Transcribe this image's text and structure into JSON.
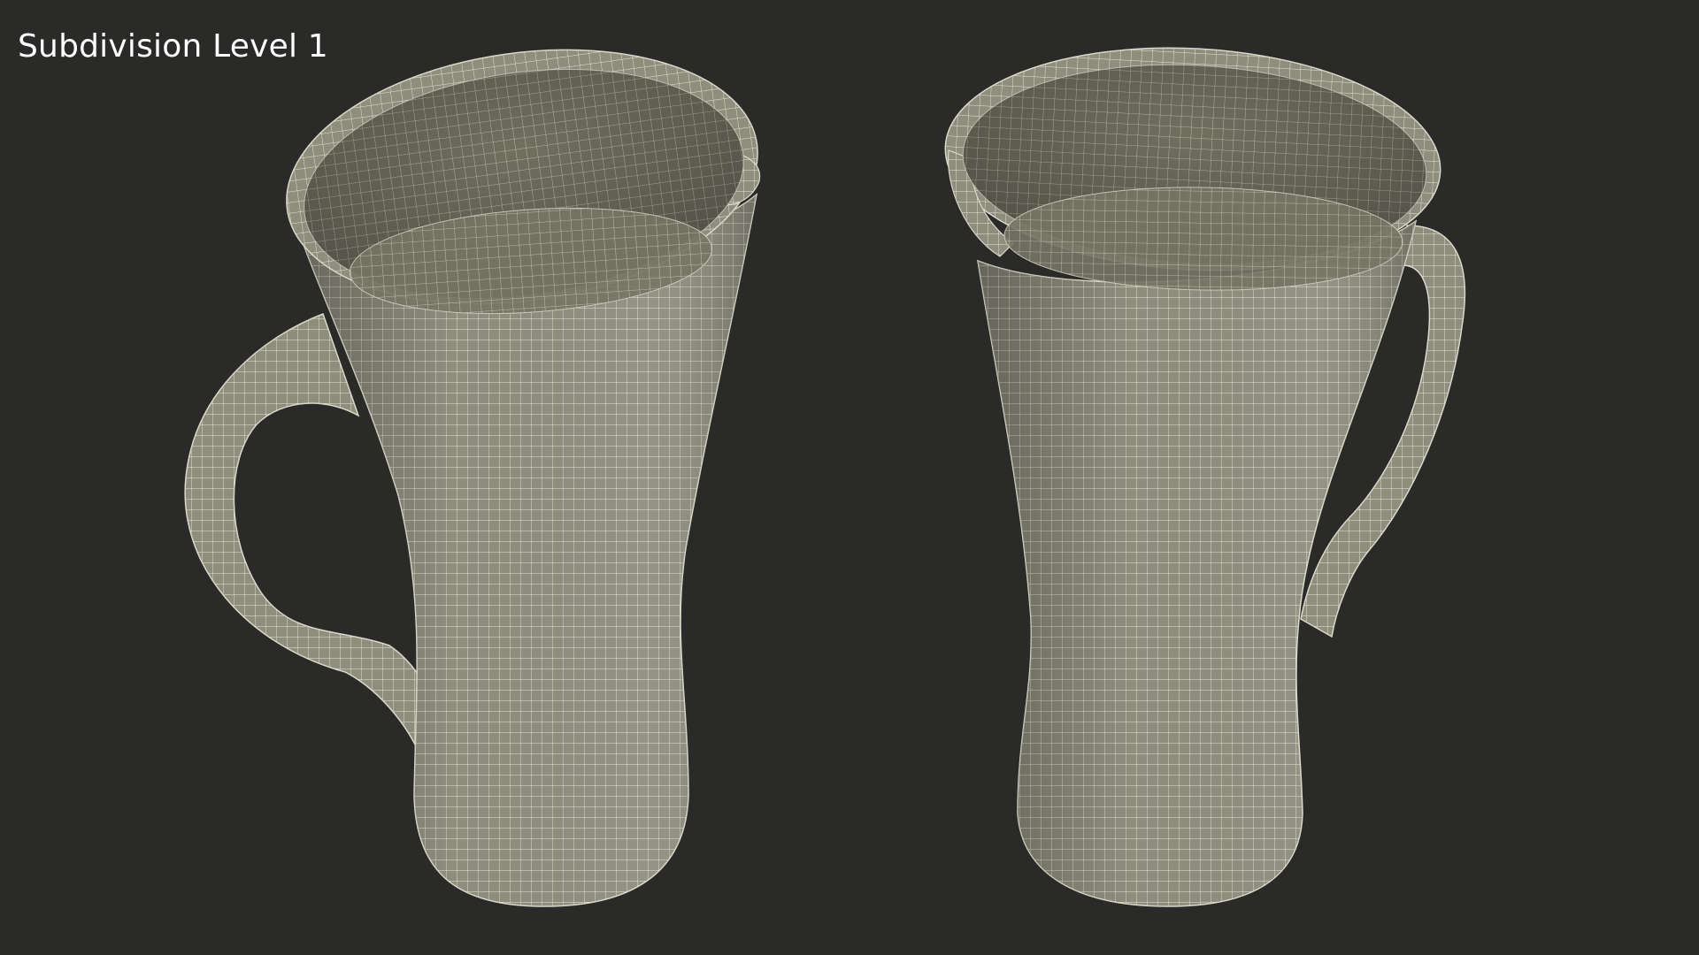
{
  "caption": "Subdivision Level 1",
  "colors": {
    "background": "#2a2a29",
    "surface": "#8e8d7e",
    "surface_light": "#a8a796",
    "interior": "#767565",
    "wire": "#e6e6d6"
  },
  "views": [
    {
      "id": "left",
      "subject": "mug-wireframe",
      "handle_side": "left"
    },
    {
      "id": "right",
      "subject": "mug-wireframe",
      "handle_side": "right"
    }
  ]
}
